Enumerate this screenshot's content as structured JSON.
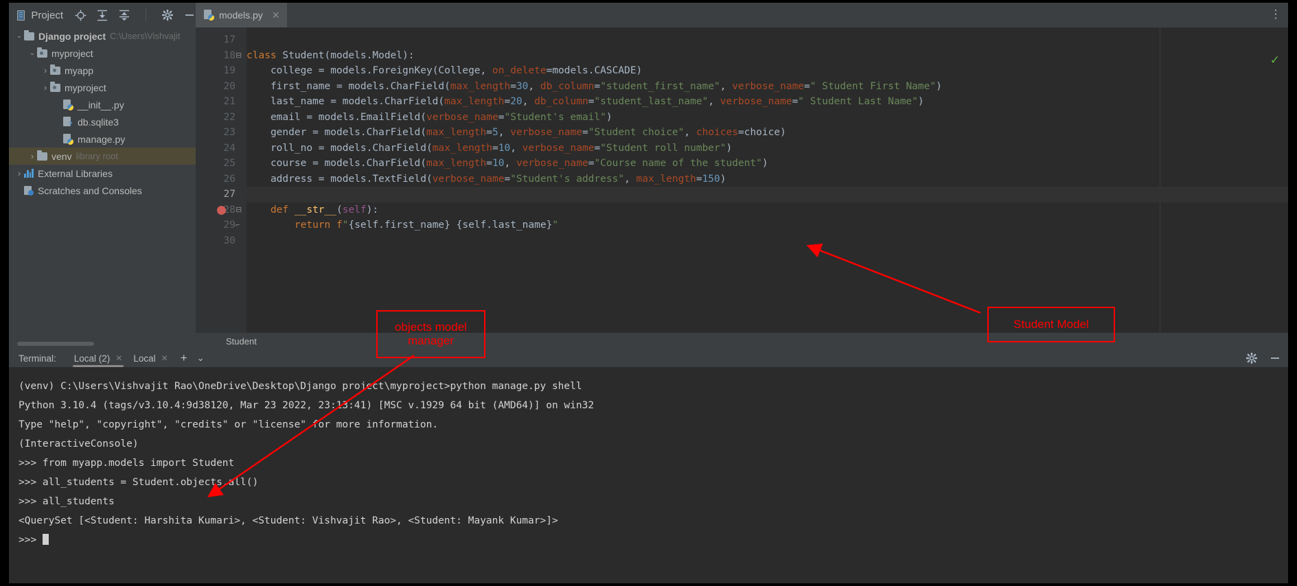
{
  "window": {
    "project_tool_label": "Project",
    "more_options": "⋮"
  },
  "toolbar_icons": [
    {
      "name": "locate-icon",
      "glyph": "⊕"
    },
    {
      "name": "expand-all-icon",
      "glyph": "⤓"
    },
    {
      "name": "collapse-all-icon",
      "glyph": "⤒"
    },
    {
      "name": "settings-gear-icon",
      "glyph": "✱"
    },
    {
      "name": "hide-panel-icon",
      "glyph": "—"
    }
  ],
  "editor_tab": {
    "filename": "models.py",
    "close": "✕"
  },
  "project_tree": [
    {
      "indent": 0,
      "arrow": "⌄",
      "icon": "folder",
      "label": "Django project",
      "sub": "C:\\Users\\Vishvajit",
      "bold": true,
      "selected": false
    },
    {
      "indent": 1,
      "arrow": "⌄",
      "icon": "folder-module",
      "label": "myproject",
      "sub": "",
      "bold": false,
      "selected": false
    },
    {
      "indent": 2,
      "arrow": "›",
      "icon": "folder-module",
      "label": "myapp",
      "sub": "",
      "bold": false,
      "selected": false
    },
    {
      "indent": 2,
      "arrow": "›",
      "icon": "folder-module",
      "label": "myproject",
      "sub": "",
      "bold": false,
      "selected": false
    },
    {
      "indent": 3,
      "arrow": "",
      "icon": "python-file",
      "label": "__init__.py",
      "sub": "",
      "bold": false,
      "selected": false
    },
    {
      "indent": 3,
      "arrow": "",
      "icon": "db-file",
      "label": "db.sqlite3",
      "sub": "",
      "bold": false,
      "selected": false
    },
    {
      "indent": 3,
      "arrow": "",
      "icon": "python-file",
      "label": "manage.py",
      "sub": "",
      "bold": false,
      "selected": false
    },
    {
      "indent": 1,
      "arrow": "›",
      "icon": "folder",
      "label": "venv",
      "sub": "library root",
      "bold": false,
      "selected": true
    },
    {
      "indent": 0,
      "arrow": "›",
      "icon": "library",
      "label": "External Libraries",
      "sub": "",
      "bold": false,
      "selected": false
    },
    {
      "indent": 0,
      "arrow": "",
      "icon": "scratches",
      "label": "Scratches and Consoles",
      "sub": "",
      "bold": false,
      "selected": false
    }
  ],
  "code": {
    "first_line_number": 17,
    "lines": [
      {
        "n": 17,
        "text": "",
        "current": false
      },
      {
        "n": 18,
        "text": "class Student(models.Model):",
        "current": false
      },
      {
        "n": 19,
        "text": "    college = models.ForeignKey(College, on_delete=models.CASCADE)",
        "current": false
      },
      {
        "n": 20,
        "text": "    first_name = models.CharField(max_length=30, db_column=\"student_first_name\", verbose_name=\" Student First Name\")",
        "current": false
      },
      {
        "n": 21,
        "text": "    last_name = models.CharField(max_length=20, db_column=\"student_last_name\", verbose_name=\" Student Last Name\")",
        "current": false
      },
      {
        "n": 22,
        "text": "    email = models.EmailField(verbose_name=\"Student's email\")",
        "current": false
      },
      {
        "n": 23,
        "text": "    gender = models.CharField(max_length=5, verbose_name=\"Student choice\", choices=choice)",
        "current": false
      },
      {
        "n": 24,
        "text": "    roll_no = models.CharField(max_length=10, verbose_name=\"Student roll number\")",
        "current": false
      },
      {
        "n": 25,
        "text": "    course = models.CharField(max_length=10, verbose_name=\"Course name of the student\")",
        "current": false
      },
      {
        "n": 26,
        "text": "    address = models.TextField(verbose_name=\"Student's address\", max_length=150)",
        "current": false
      },
      {
        "n": 27,
        "text": "",
        "current": true
      },
      {
        "n": 28,
        "text": "    def __str__(self):",
        "current": false
      },
      {
        "n": 29,
        "text": "        return f\"{self.first_name} {self.last_name}\"",
        "current": false
      },
      {
        "n": 30,
        "text": "",
        "current": false
      }
    ]
  },
  "breadcrumb": "Student",
  "terminal": {
    "label": "Terminal:",
    "tabs": [
      {
        "label": "Local (2)",
        "close": "✕",
        "active": true
      },
      {
        "label": "Local",
        "close": "✕",
        "active": false
      }
    ],
    "add": "+",
    "chevron": "⌄",
    "settings_icon": "✱",
    "minimize_icon": "—",
    "output": [
      "(venv) C:\\Users\\Vishvajit Rao\\OneDrive\\Desktop\\Django project\\myproject>python manage.py shell",
      "Python 3.10.4 (tags/v3.10.4:9d38120, Mar 23 2022, 23:13:41) [MSC v.1929 64 bit (AMD64)] on win32",
      "Type \"help\", \"copyright\", \"credits\" or \"license\" for more information.",
      "(InteractiveConsole)",
      ">>> from myapp.models import Student",
      ">>> all_students = Student.objects.all()",
      ">>> all_students",
      "<QuerySet [<Student: Harshita Kumari>, <Student: Vishvajit Rao>, <Student: Mayank Kumar>]>",
      ">>> "
    ]
  },
  "annotations": [
    {
      "name": "objects-model-manager-callout",
      "text": "objects model manager",
      "color": "#ff0000"
    },
    {
      "name": "student-model-callout",
      "text": "Student Model",
      "color": "#ff0000"
    }
  ]
}
